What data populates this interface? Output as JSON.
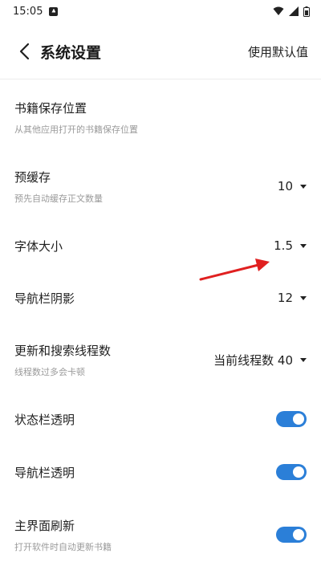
{
  "status_bar": {
    "time": "15:05"
  },
  "header": {
    "title": "系统设置",
    "reset_label": "使用默认值"
  },
  "settings": [
    {
      "title": "书籍保存位置",
      "subtitle": "从其他应用打开的书籍保存位置"
    },
    {
      "title": "预缓存",
      "subtitle": "预先自动缓存正文数量",
      "value": "10"
    },
    {
      "title": "字体大小",
      "value": "1.5"
    },
    {
      "title": "导航栏阴影",
      "value": "12"
    },
    {
      "title": "更新和搜索线程数",
      "subtitle": "线程数过多会卡顿",
      "value": "当前线程数 40"
    },
    {
      "title": "状态栏透明",
      "toggle": true
    },
    {
      "title": "导航栏透明",
      "toggle": true
    },
    {
      "title": "主界面刷新",
      "subtitle": "打开软件时自动更新书籍",
      "toggle": true
    }
  ],
  "colors": {
    "toggle_on": "#2b7fd8",
    "annotation_arrow": "#e02020"
  }
}
